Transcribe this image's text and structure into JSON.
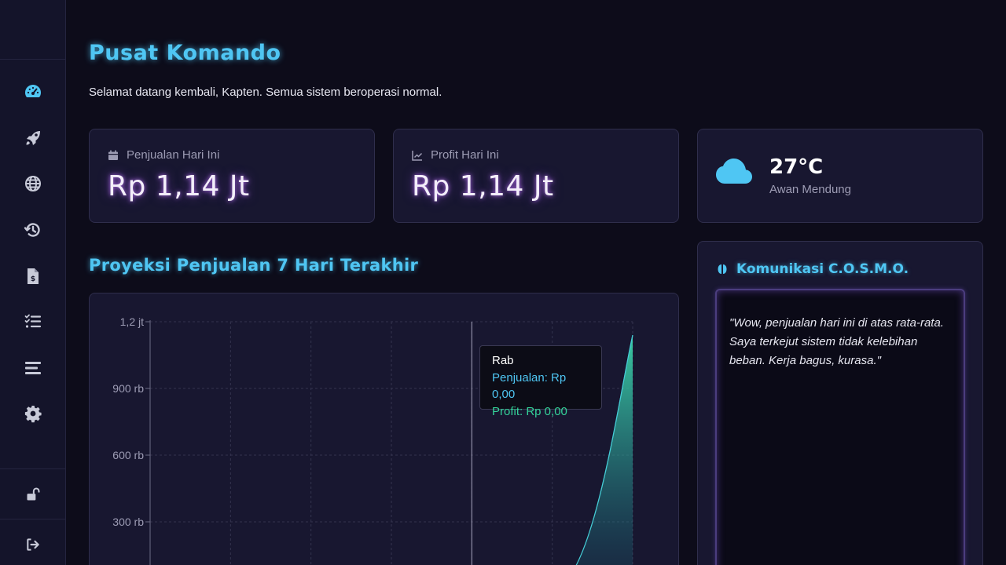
{
  "header": {
    "title": "Pusat Komando",
    "subtitle": "Selamat datang kembali, Kapten. Semua sistem beroperasi normal."
  },
  "sidebar": {
    "items": [
      {
        "icon": "dashboard-gauge-icon",
        "active": true
      },
      {
        "icon": "rocket-icon"
      },
      {
        "icon": "globe-icon"
      },
      {
        "icon": "history-icon"
      },
      {
        "icon": "invoice-dollar-icon"
      },
      {
        "icon": "task-list-icon"
      },
      {
        "icon": "bars-icon"
      },
      {
        "icon": "gear-icon"
      }
    ],
    "bottom": [
      {
        "icon": "unlock-icon"
      },
      {
        "icon": "logout-icon"
      }
    ]
  },
  "stats": {
    "sales": {
      "label": "Penjualan Hari Ini",
      "value": "Rp 1,14 Jt"
    },
    "profit": {
      "label": "Profit Hari Ini",
      "value": "Rp 1,14 Jt"
    }
  },
  "weather": {
    "temp": "27°C",
    "desc": "Awan Mendung"
  },
  "chart_section": {
    "title": "Proyeksi Penjualan 7 Hari Terakhir"
  },
  "chart_data": {
    "type": "area",
    "y_tick_labels": [
      "1,2 jt",
      "900 rb",
      "600 rb",
      "300 rb"
    ],
    "y_ticks": [
      1200000,
      900000,
      600000,
      300000
    ],
    "ylim": [
      0,
      1200000
    ],
    "x_count": 7,
    "series": [
      {
        "name": "Penjualan",
        "values": [
          0,
          0,
          0,
          0,
          0,
          0,
          1140000
        ]
      },
      {
        "name": "Profit",
        "values": [
          0,
          0,
          0,
          0,
          0,
          0,
          1140000
        ]
      }
    ],
    "tooltip": {
      "title": "Rab",
      "sales": "Penjualan: Rp 0,00",
      "profit": "Profit: Rp 0,00",
      "index": 4
    },
    "colors": {
      "sales": "#4fc6f3",
      "profit": "#34d399"
    }
  },
  "comms": {
    "title": "Komunikasi C.O.S.M.O.",
    "message": "\"Wow, penjualan hari ini di atas rata-rata. Saya terkejut sistem tidak kelebihan beban. Kerja bagus, kurasa.\""
  },
  "colors": {
    "accent": "#4fc6f3",
    "glow": "#c378ff",
    "background": "#0d0c1a",
    "card": "#181730"
  }
}
